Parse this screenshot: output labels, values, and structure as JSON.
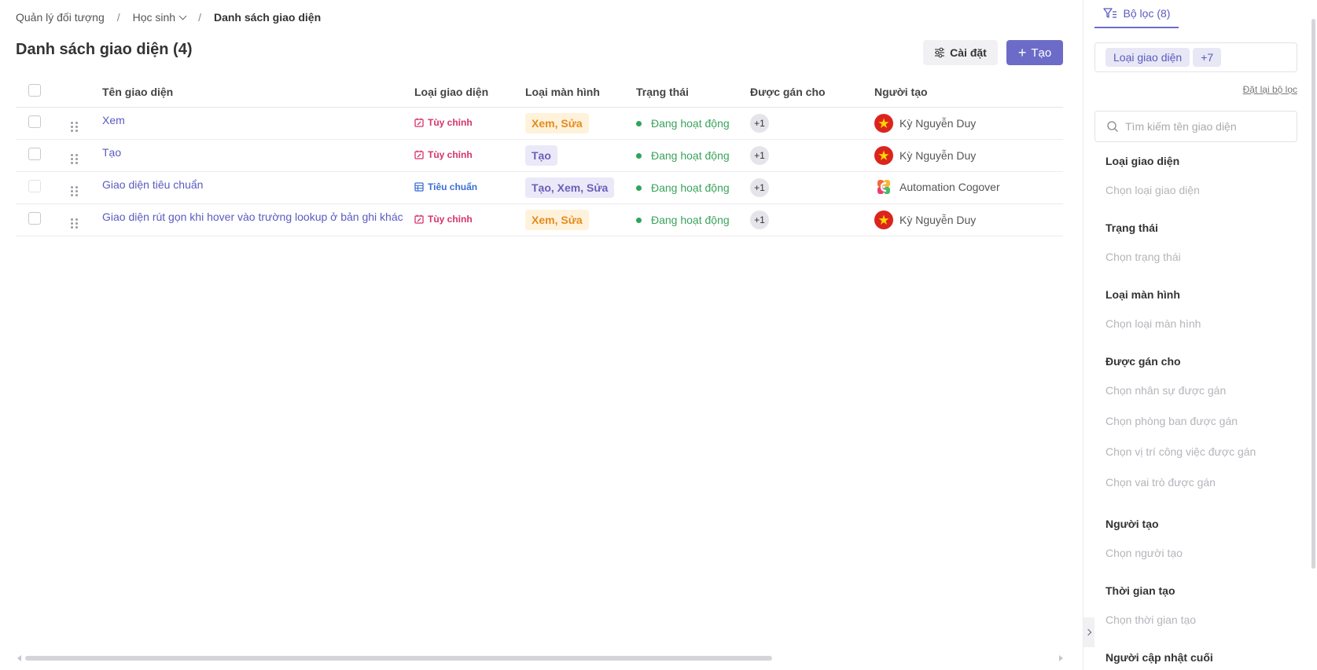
{
  "breadcrumb": {
    "items": [
      "Quản lý đối tượng",
      "Học sinh",
      "Danh sách giao diện"
    ],
    "separator": "/"
  },
  "page": {
    "title": "Danh sách giao diện (4)"
  },
  "toolbar": {
    "settings_label": "Cài đặt",
    "create_label": "Tạo",
    "accent_color": "#6c6cc8"
  },
  "table": {
    "columns": [
      "Tên giao diện",
      "Loại giao diện",
      "Loại màn hình",
      "Trạng thái",
      "Được gán cho",
      "Người tạo"
    ],
    "rows": [
      {
        "name": "Xem",
        "type": "Tùy chỉnh",
        "type_kind": "custom",
        "screen": "Xem, Sửa",
        "screen_color": "orange",
        "status": "Đang hoạt động",
        "assigned": "+1",
        "creator": "Kỳ Nguyễn Duy",
        "avatar": "flag-vn",
        "checkbox_disabled": false
      },
      {
        "name": "Tạo",
        "type": "Tùy chỉnh",
        "type_kind": "custom",
        "screen": "Tạo",
        "screen_color": "purple",
        "status": "Đang hoạt động",
        "assigned": "+1",
        "creator": "Kỳ Nguyễn Duy",
        "avatar": "flag-vn",
        "checkbox_disabled": false
      },
      {
        "name": "Giao diện tiêu chuẩn",
        "type": "Tiêu chuẩn",
        "type_kind": "standard",
        "screen": "Tạo, Xem, Sửa",
        "screen_color": "purple",
        "status": "Đang hoạt động",
        "assigned": "+1",
        "creator": "Automation Cogover",
        "avatar": "cogover-logo",
        "checkbox_disabled": true
      },
      {
        "name": "Giao diện rút gọn khi hover vào trường lookup ở bản ghi khác",
        "type": "Tùy chỉnh",
        "type_kind": "custom",
        "screen": "Xem, Sửa",
        "screen_color": "orange",
        "status": "Đang hoạt động",
        "assigned": "+1",
        "creator": "Kỳ Nguyễn Duy",
        "avatar": "flag-vn",
        "checkbox_disabled": false
      }
    ]
  },
  "filter_panel": {
    "tab_label": "Bộ lọc (8)",
    "active_chips": [
      "Loại giao diện",
      "+7"
    ],
    "reset_label": "Đặt lại bộ lọc",
    "search_placeholder": "Tìm kiếm tên giao diện",
    "sections": [
      {
        "title": "Loại giao diện",
        "options": [
          "Chọn loại giao diện"
        ]
      },
      {
        "title": "Trạng thái",
        "options": [
          "Chọn trạng thái"
        ]
      },
      {
        "title": "Loại màn hình",
        "options": [
          "Chọn loại màn hình"
        ]
      },
      {
        "title": "Được gán cho",
        "options": [
          "Chọn nhân sự được gán",
          "Chọn phòng ban được gán",
          "Chọn vị trí công việc được gán",
          "Chọn vai trò được gán"
        ]
      },
      {
        "title": "Người tạo",
        "options": [
          "Chọn người tạo"
        ]
      },
      {
        "title": "Thời gian tạo",
        "options": [
          "Chọn thời gian tạo"
        ]
      },
      {
        "title": "Người cập nhật cuối",
        "options": []
      }
    ]
  },
  "icons": {
    "settings": "sliders-icon",
    "create": "plus-icon",
    "filter": "filter-icon",
    "search": "search-icon",
    "custom_type": "calendar-edit-icon",
    "standard_type": "grid-table-icon"
  }
}
